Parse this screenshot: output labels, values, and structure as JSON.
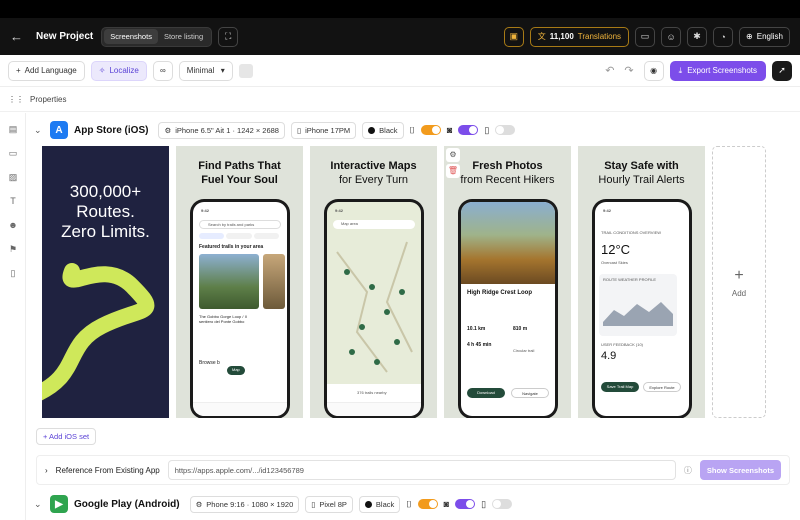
{
  "header": {
    "project_title": "New Project",
    "tabs": [
      "Screenshots",
      "Store listing"
    ],
    "translations_count": "11,100",
    "translations_label": "Translations",
    "language": "English"
  },
  "toolbar": {
    "add_language": "Add Language",
    "localize": "Localize",
    "style_select": "Minimal",
    "export_label": "Export Screenshots"
  },
  "properties_label": "Properties",
  "ios": {
    "title": "App Store (iOS)",
    "device": "iPhone 6.5\" Ait 1 · 1242 × 2688",
    "model": "iPhone 17PM",
    "color": "Black",
    "add_set": "+ Add iOS set",
    "add_label": "Add"
  },
  "screens": [
    {
      "line1": "300,000+",
      "line2": "Routes.",
      "line3": "Zero Limits."
    },
    {
      "line1": "Find Paths That",
      "line2": "Fuel Your Soul"
    },
    {
      "line1": "Interactive Maps",
      "line2": "for Every Turn"
    },
    {
      "line1": "Fresh Photos",
      "line2": "from Recent Hikers"
    },
    {
      "line1": "Stay Safe with",
      "line2": "Hourly Trail Alerts"
    }
  ],
  "phone_ui": {
    "time": "9:42",
    "search_trails": "Search by trails and parks",
    "featured": "Featured trails in your area",
    "trail_name": "The Gobbo Gorge Loop / Il sentiero del Ponte Gobbo",
    "browse": "Browse b",
    "map_label": "Map",
    "map_search": "Map area",
    "trails_nearby": "376 trails nearby",
    "trail_title": "High Ridge Crest Loop",
    "distance": "10.1 km",
    "elevation": "810 m",
    "duration": "4 h 45 min",
    "route_type": "Circular trail",
    "download": "Download",
    "navigate": "Navigate",
    "conditions": "TRAIL CONDITIONS OVERVIEW",
    "temp": "12°C",
    "sky": "Overcast Skies",
    "profile": "ROUTE WEATHER PROFILE",
    "feedback": "USER FEEDBACK (10)",
    "rating": "4.9",
    "save_map": "Save Trail Map",
    "explore": "Explore Route"
  },
  "reference": {
    "label": "Reference From Existing App",
    "url": "https://apps.apple.com/.../id123456789",
    "button": "Show Screenshots"
  },
  "android": {
    "title": "Google Play (Android)",
    "device": "Phone 9:16 · 1080 × 1920",
    "model": "Pixel 8P",
    "color": "Black"
  },
  "colors": {
    "accent": "#7c4dea",
    "dark_bg": "#121212",
    "gold": "#f0b43c",
    "lime": "#cfe85a",
    "navy": "#1f2240"
  }
}
